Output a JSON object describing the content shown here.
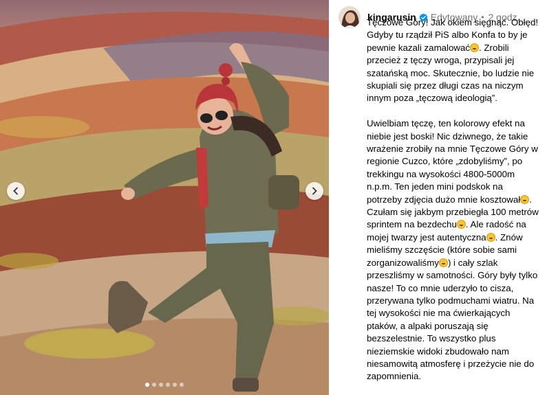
{
  "post": {
    "username": "kingarusin",
    "edited_label": "Edytowany",
    "separator": "•",
    "time": "2 godz.",
    "carousel": {
      "slides": 6,
      "active_index": 0
    },
    "caption": {
      "p1": [
        "Tęczowe Góry! Jak okiem sięgnąć. Obłęd! Gdyby tu rządził PiS albo Konfa to by je pewnie kazali zamalować",
        ". Zrobili przecież z tęczy wroga, przypisali jej szatańską moc. Skutecznie, bo ludzie nie skupiali się przez długi czas na niczym innym poza „tęczową ideologią”."
      ],
      "p2": [
        "Uwielbiam tęczę, ten kolorowy efekt na niebie jest boski! Nic dziwnego, że takie wrażenie zrobiły na mnie Tęczowe Góry w regionie Cuzco, które „zdobyliśmy”, po trekkingu na wysokości 4800-5000m n.p.m. Ten jeden mini podskok na potrzeby zdjęcia dużo mnie kosztował",
        ". Czułam się jakbym przebiegła 100 metrów sprintem na bezdechu",
        ". Ale radość na mojej twarzy jest autentyczna",
        ". Znów mieliśmy szczęście (które sobie sami zorganizowaliśmy",
        ") i cały szlak przeszliśmy w samotności. Góry były tylko nasze! To co mnie uderzyło to cisza, przerywana tylko podmuchami wiatru. Na tej wysokości nie ma ćwierkających ptaków, a alpaki poruszają się bezszelestnie. To wszystko plus nieziemskie widoki zbudowało nam niesamowitą atmosferę i przeżycie nie do zapomnienia."
      ]
    }
  },
  "icons": {
    "prev": "chevron-left-icon",
    "next": "chevron-right-icon",
    "verified": "verified-badge-icon",
    "emoji": "laughing-emoji-icon"
  },
  "colors": {
    "verified": "#0095f6",
    "muted_text": "#737373",
    "emoji": "#f7c531"
  }
}
